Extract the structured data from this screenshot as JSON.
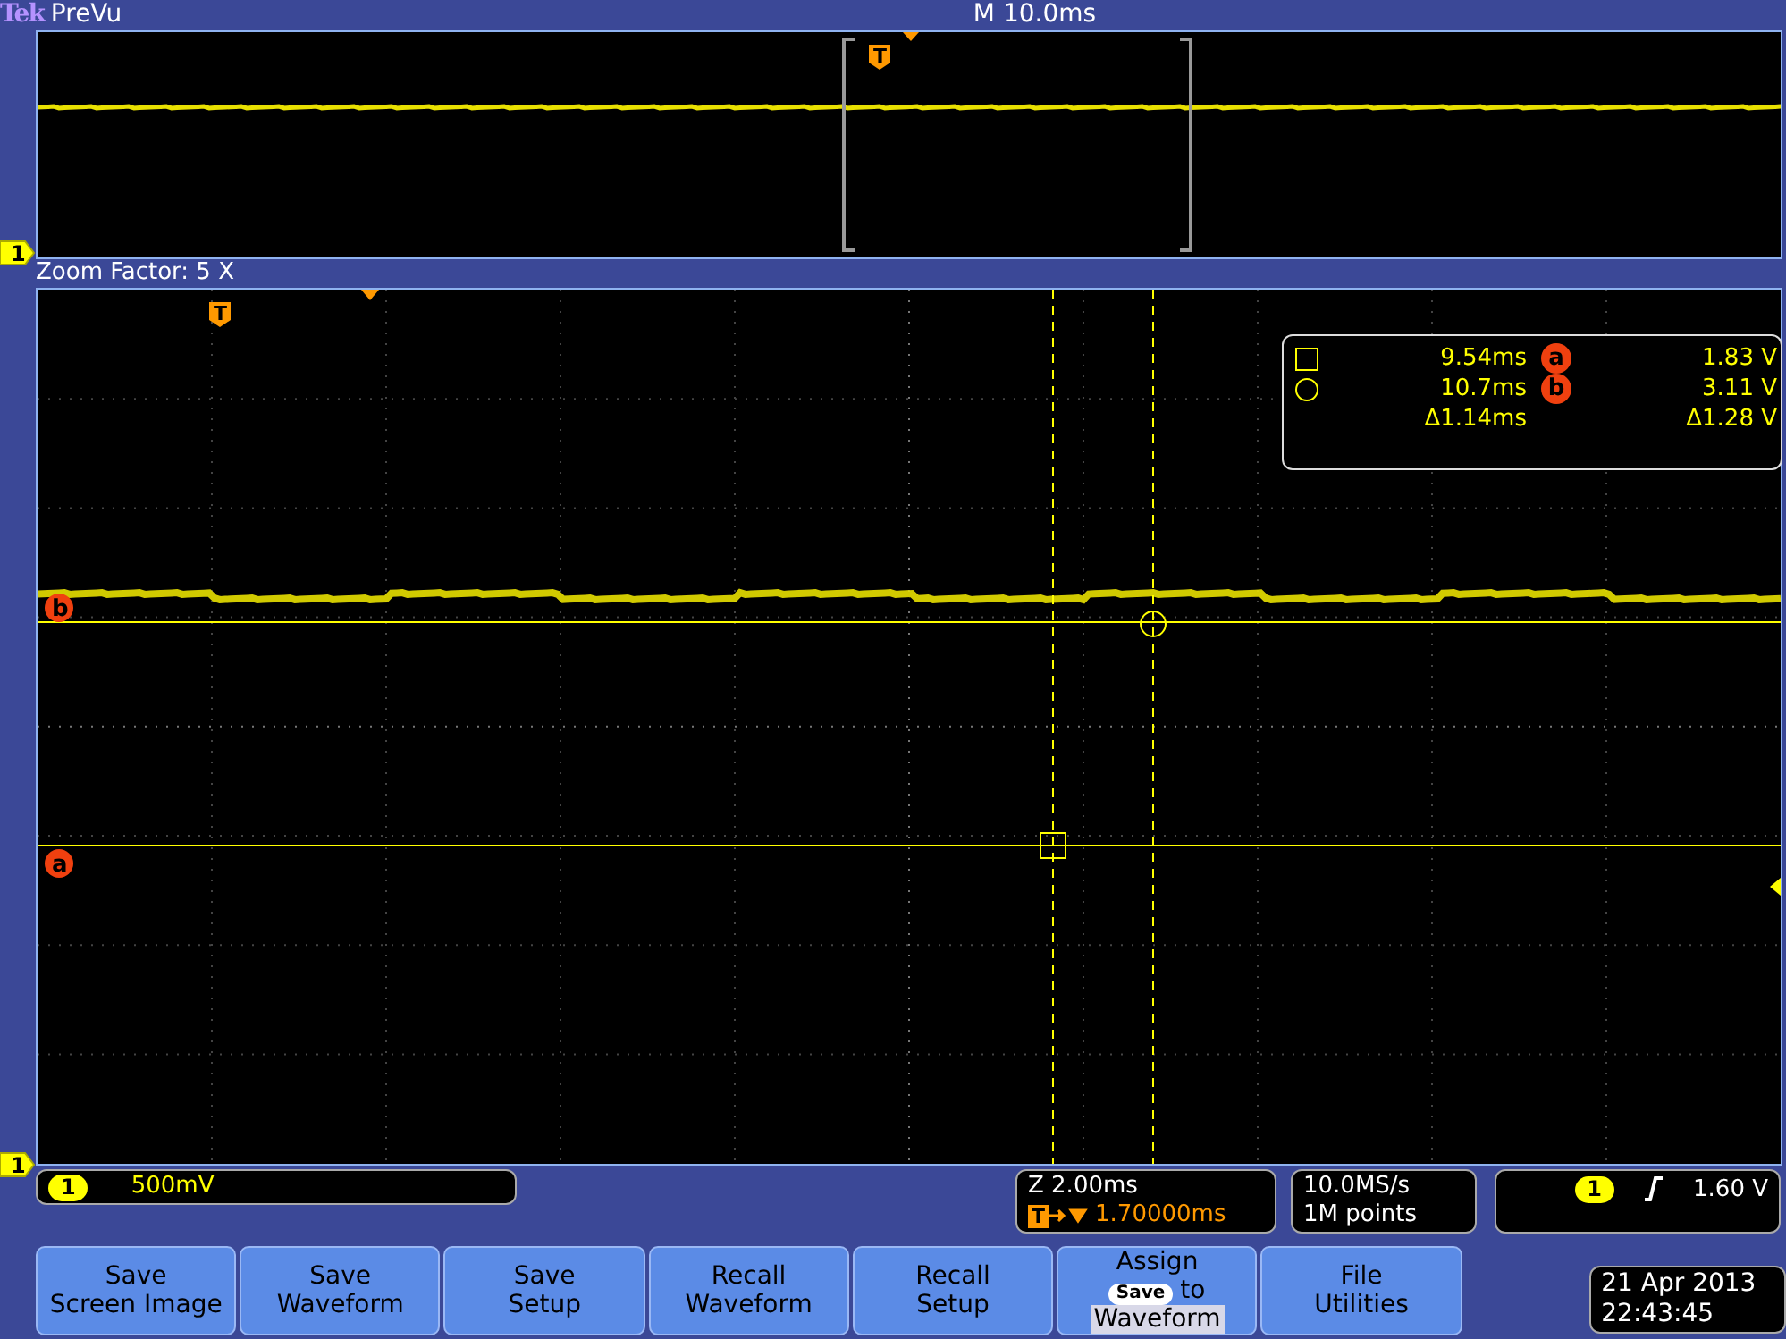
{
  "header": {
    "logo": "Tek",
    "title": "PreVu",
    "timebase": "M 10.0ms"
  },
  "overview": {
    "trigger_label": "T",
    "channel_marker": "1"
  },
  "zoom": {
    "label": "Zoom Factor: 5 X",
    "trigger_label": "T",
    "channel_marker": "1",
    "cursor_labels": [
      {
        "kind": "b",
        "text": "b"
      },
      {
        "kind": "a",
        "text": "a"
      }
    ],
    "cursor_readout": [
      {
        "kind": "square",
        "time": "9.54ms",
        "source": "a",
        "value": "1.83 V"
      },
      {
        "kind": "circle",
        "time": "10.7ms",
        "source": "b",
        "value": "3.11 V"
      },
      {
        "kind": "delta",
        "time": "Δ1.14ms",
        "value": "Δ1.28 V"
      }
    ]
  },
  "channel": {
    "number": "1",
    "scale": "500mV"
  },
  "horizontal": {
    "zoom": "Z 2.00ms",
    "trigger_icon": "T",
    "trigger_position": "1.70000ms"
  },
  "acquisition": {
    "sample_rate": "10.0MS/s",
    "record_length": "1M points"
  },
  "trigger": {
    "channel": "1",
    "level": "1.60 V"
  },
  "buttons": [
    {
      "kind": "text",
      "lines": [
        "Save",
        "Screen Image"
      ]
    },
    {
      "kind": "text",
      "lines": [
        "Save",
        "Waveform"
      ]
    },
    {
      "kind": "text",
      "lines": [
        "Save",
        "Setup"
      ]
    },
    {
      "kind": "text",
      "lines": [
        "Recall",
        "Waveform"
      ]
    },
    {
      "kind": "text",
      "lines": [
        "Recall",
        "Setup"
      ]
    },
    {
      "kind": "assign",
      "lines": [
        "Assign"
      ],
      "key": "Save",
      "suffix": "to",
      "highlight": "Waveform"
    },
    {
      "kind": "text",
      "lines": [
        "File",
        "Utilities"
      ]
    }
  ],
  "datetime": {
    "date": "21 Apr 2013",
    "time": "22:43:45"
  }
}
